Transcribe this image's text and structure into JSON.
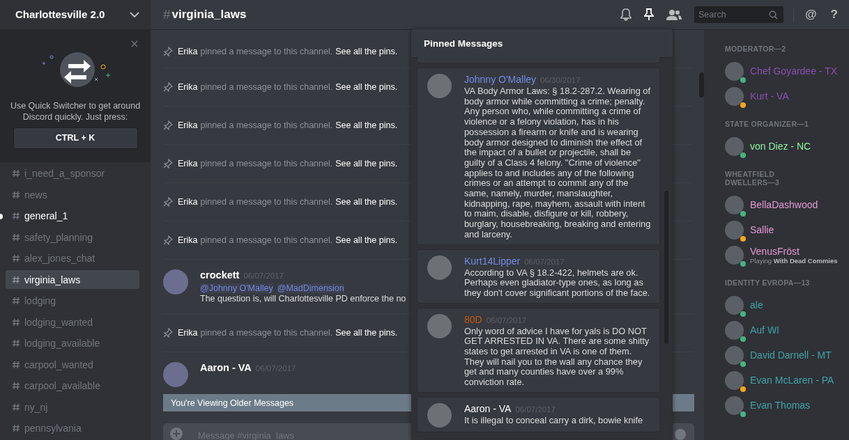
{
  "server": {
    "name": "Charlottesville 2.0"
  },
  "quick_switcher": {
    "text": "Use Quick Switcher to get around Discord quickly. Just press:",
    "shortcut": "CTRL + K"
  },
  "channels": [
    {
      "name": "i_need_a_sponsor",
      "selected": false,
      "unread": false
    },
    {
      "name": "news",
      "selected": false,
      "unread": false
    },
    {
      "name": "general_1",
      "selected": false,
      "unread": true
    },
    {
      "name": "safety_planning",
      "selected": false,
      "unread": false
    },
    {
      "name": "alex_jones_chat",
      "selected": false,
      "unread": false
    },
    {
      "name": "virginia_laws",
      "selected": true,
      "unread": false
    },
    {
      "name": "lodging",
      "selected": false,
      "unread": false
    },
    {
      "name": "lodging_wanted",
      "selected": false,
      "unread": false
    },
    {
      "name": "lodging_available",
      "selected": false,
      "unread": false
    },
    {
      "name": "carpool_wanted",
      "selected": false,
      "unread": false
    },
    {
      "name": "carpool_available",
      "selected": false,
      "unread": false
    },
    {
      "name": "ny_nj",
      "selected": false,
      "unread": false
    },
    {
      "name": "pennsylvania",
      "selected": false,
      "unread": false
    }
  ],
  "header": {
    "hash": "#",
    "channel": "virginia_laws",
    "search_placeholder": "Search",
    "glyphs": [
      "@",
      "?"
    ]
  },
  "messages": [
    {
      "kind": "system",
      "author": "Erika",
      "text": "pinned a message to this channel.",
      "link": "See all the pins."
    },
    {
      "kind": "system",
      "author": "Erika",
      "text": "pinned a message to this channel.",
      "link": "See all the pins."
    },
    {
      "kind": "system",
      "author": "Erika",
      "text": "pinned a message to this channel.",
      "link": "See all the pins."
    },
    {
      "kind": "system",
      "author": "Erika",
      "text": "pinned a message to this channel.",
      "link": "See all the pins."
    },
    {
      "kind": "system",
      "author": "Erika",
      "text": "pinned a message to this channel.",
      "link": "See all the pins."
    },
    {
      "kind": "system",
      "author": "Erika",
      "text": "pinned a message to this channel.",
      "link": "See all the pins."
    },
    {
      "kind": "user",
      "author": "crockett",
      "timestamp": "06/07/2017",
      "mentions": [
        "@Johnny O'Malley",
        "@MadDimension"
      ],
      "text": "The question is, will Charlottesville PD enforce the no"
    },
    {
      "kind": "system",
      "author": "Erika",
      "text": "pinned a message to this channel.",
      "link": "See all the pins."
    },
    {
      "kind": "user",
      "author": "Aaron - VA",
      "timestamp": "06/07/2017"
    }
  ],
  "older_notice": "You're Viewing Older Messages",
  "composer": {
    "placeholder": "Message #virginia_laws"
  },
  "pinned": {
    "title": "Pinned Messages",
    "items": [
      {
        "author": "Johnny O'Malley",
        "color": "#6f8de6",
        "date": "06/30/2017",
        "text": "VA Body Armor Laws: § 18.2-287.2. Wearing of body armor while committing a crime; penalty. Any person who, while committing a crime of violence or a felony violation, has in his possession a firearm or knife and is wearing body armor designed to diminish the effect of the impact of a bullet or projectile, shall be guilty of a Class 4 felony.  \"Crime of violence\" applies to and includes any of the following crimes or an attempt to commit any of the same, namely, murder, manslaughter, kidnapping, rape, mayhem, assault with intent to maim, disable, disfigure or kill, robbery, burglary, housebreaking, breaking and entering and larceny."
      },
      {
        "author": "Kurt14Lipper",
        "color": "#6f8de6",
        "date": "06/07/2017",
        "text": "According to VA § 18.2-422, helmets are ok. Perhaps even gladiator-type ones, as long as they don't cover significant portions of the face."
      },
      {
        "author": "80D",
        "color": "#c4580e",
        "date": "06/07/2017",
        "text": "Only word of advice I have for yals is DO NOT GET ARRESTED IN VA. There are some shitty states to get arrested in VA is one of them. They will nail you to the wall any chance they get and many counties have over a 99% conviction rate."
      },
      {
        "author": "Aaron - VA",
        "color": "#ffffff",
        "date": "06/07/2017",
        "text": "It is illegal to conceal carry a dirk, bowie knife"
      }
    ]
  },
  "member_groups": [
    {
      "title": "MODERATOR—2",
      "color": "#8c4fb0",
      "members": [
        {
          "name": "Chef Goyardee - TX",
          "color": "#43b581"
        },
        {
          "name": "Kurt - VA",
          "color": "#faa61a"
        }
      ]
    },
    {
      "title": "STATE ORGANIZER—1",
      "color": "#8ef3a0",
      "members": [
        {
          "name": "von Diez - NC",
          "color": "#43b581"
        }
      ]
    },
    {
      "title": "WHEATFIELD DWELLERS—3",
      "color": "#e69ad8",
      "members": [
        {
          "name": "BellaDashwood",
          "color": "#43b581"
        },
        {
          "name": "Sallie",
          "color": "#faa61a"
        },
        {
          "name": "VenusFröst",
          "color": "#43b581",
          "activity": "Playing **With Dead Commies**"
        }
      ]
    },
    {
      "title": "IDENTITY EVROPA—13",
      "color": "#3fa3a8",
      "members": [
        {
          "name": "ale",
          "color": "#43b581"
        },
        {
          "name": "Auf WI",
          "color": "#43b581"
        },
        {
          "name": "David Darnell - MT",
          "color": "#43b581"
        },
        {
          "name": "Evan McLaren - PA",
          "color": "#faa61a"
        },
        {
          "name": "Evan Thomas",
          "color": "#43b581"
        }
      ]
    }
  ]
}
